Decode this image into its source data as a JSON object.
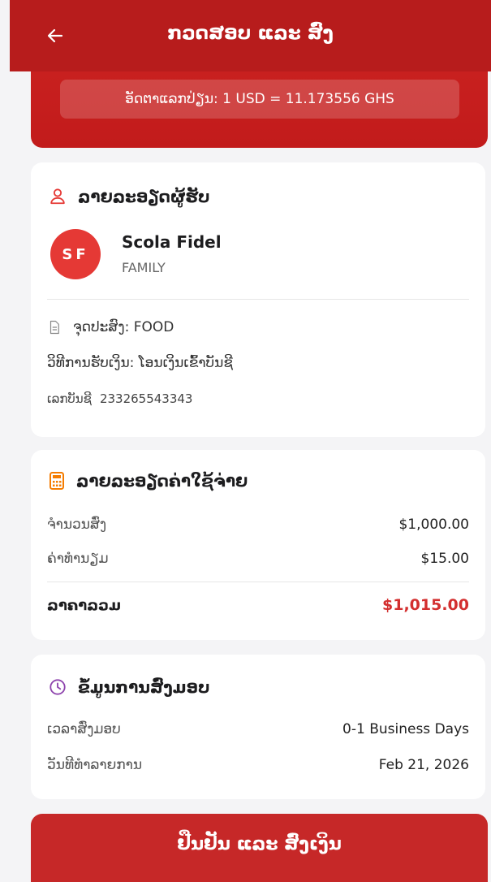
{
  "header": {
    "title": "ກວດສອບ ແລະ ສົ່ງ"
  },
  "rate": {
    "text": "ອັດຕາແລກປ່ຽນ: 1 USD = 11.173556 GHS"
  },
  "recipient": {
    "title": "ລາຍລະອຽດຜູ້ຮັບ",
    "initials": "SF",
    "name": "Scola Fidel",
    "relation": "FAMILY",
    "purpose": "ຈຸດປະສົງ: FOOD",
    "method": "ວິທີການຮັບເງິນ: ໂອນເງິນເຂົ້າບັນຊີ",
    "account_label": "ເລກບັນຊີ",
    "account_number": "233265543343"
  },
  "costs": {
    "title": "ລາຍລະອຽດຄ່າໃຊ້ຈ່າຍ",
    "rows": [
      {
        "label": "ຈຳນວນສົ່ງ",
        "value": "$1,000.00"
      },
      {
        "label": "ຄ່າທຳນຽມ",
        "value": "$15.00"
      }
    ],
    "total_label": "ລາຄາລວມ",
    "total_value": "$1,015.00"
  },
  "delivery": {
    "title": "ຂໍ້ມູນການສົ່ງມອບ",
    "rows": [
      {
        "label": "ເວລາສົ່ງມອບ",
        "value": "0-1 Business Days"
      },
      {
        "label": "ວັນທີທຳລາຍການ",
        "value": "Feb 21, 2026"
      }
    ]
  },
  "confirm": {
    "label": "ຢືນຢັນ ແລະ ສົ່ງເງິນ"
  },
  "colors": {
    "brand": "#b71c1c",
    "accent": "#e53935",
    "total": "#d32f2f",
    "background": "#f4f4f6"
  },
  "icons": {
    "back": "arrow-left-icon",
    "recipient": "user-icon",
    "purpose": "document-icon",
    "costs": "calculator-icon",
    "delivery": "clock-icon"
  }
}
